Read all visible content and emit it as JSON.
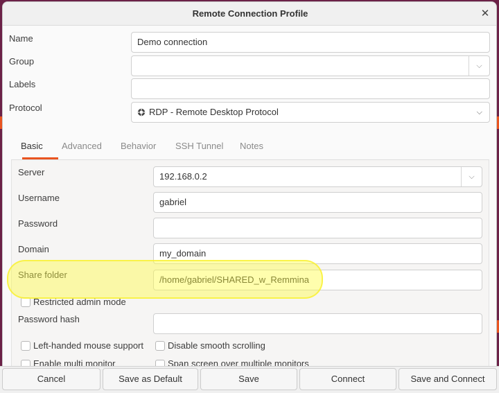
{
  "window": {
    "title": "Remote Connection Profile"
  },
  "profile": {
    "name_label": "Name",
    "name_value": "Demo connection",
    "group_label": "Group",
    "group_value": "",
    "labels_label": "Labels",
    "labels_value": "",
    "protocol_label": "Protocol",
    "protocol_value": "RDP - Remote Desktop Protocol"
  },
  "tabs": [
    {
      "label": "Basic",
      "active": true
    },
    {
      "label": "Advanced",
      "active": false
    },
    {
      "label": "Behavior",
      "active": false
    },
    {
      "label": "SSH Tunnel",
      "active": false
    },
    {
      "label": "Notes",
      "active": false
    }
  ],
  "basic": {
    "server_label": "Server",
    "server_value": "192.168.0.2",
    "username_label": "Username",
    "username_value": "gabriel",
    "password_label": "Password",
    "password_value": "",
    "domain_label": "Domain",
    "domain_value": "my_domain",
    "share_folder_label": "Share folder",
    "share_folder_value": "/home/gabriel/SHARED_w_Remmina",
    "restricted_admin_label": "Restricted admin mode",
    "password_hash_label": "Password hash",
    "password_hash_value": "",
    "left_handed_label": "Left-handed mouse support",
    "disable_smooth_label": "Disable smooth scrolling",
    "multi_monitor_label": "Enable multi monitor",
    "span_screen_label": "Span screen over multiple monitors"
  },
  "buttons": {
    "cancel": "Cancel",
    "save_default": "Save as Default",
    "save": "Save",
    "connect": "Connect",
    "save_connect": "Save and Connect"
  },
  "icons": {
    "close": "close-icon",
    "chevron": "chevron-down-icon",
    "protocol": "rdp-protocol-icon"
  },
  "colors": {
    "accent": "#e95420",
    "highlight": "#fff83c"
  }
}
